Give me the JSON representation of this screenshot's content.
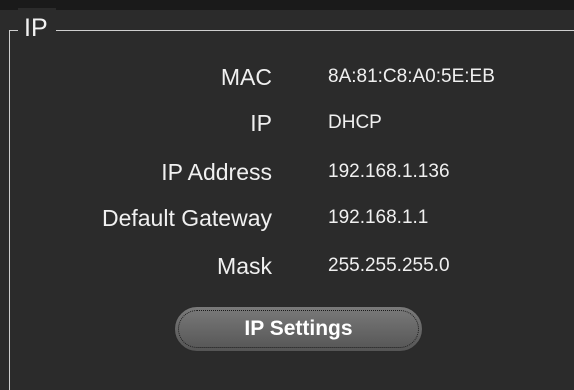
{
  "group": {
    "title": "IP"
  },
  "fields": [
    {
      "label": "MAC",
      "value": "8A:81:C8:A0:5E:EB"
    },
    {
      "label": "IP",
      "value": "DHCP"
    },
    {
      "label": "IP Address",
      "value": "192.168.1.136"
    },
    {
      "label": "Default Gateway",
      "value": "192.168.1.1"
    },
    {
      "label": "Mask",
      "value": "255.255.255.0"
    }
  ],
  "button": {
    "label": "IP Settings"
  }
}
